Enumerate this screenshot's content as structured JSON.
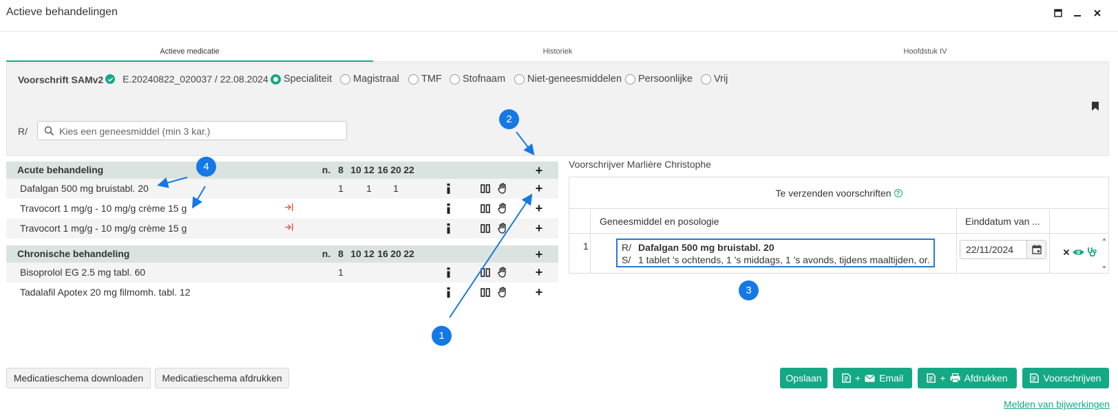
{
  "window": {
    "title": "Actieve behandelingen",
    "buttons": [
      "maximize-icon",
      "minimize-icon",
      "close-icon"
    ]
  },
  "tabs": [
    {
      "label": "Actieve medicatie",
      "active": true
    },
    {
      "label": "Historiek",
      "active": false
    },
    {
      "label": "Hoofdstuk IV",
      "active": false
    }
  ],
  "prescription": {
    "samv2_label": "Voorschrift SAMv2",
    "reference": "E.20240822_020037 / 22.08.2024",
    "types": [
      {
        "label": "Specialiteit",
        "selected": true
      },
      {
        "label": "Magistraal",
        "selected": false
      },
      {
        "label": "TMF",
        "selected": false
      },
      {
        "label": "Stofnaam",
        "selected": false
      },
      {
        "label": "Niet-geneesmiddelen",
        "selected": false
      },
      {
        "label": "Persoonlijke",
        "selected": false
      },
      {
        "label": "Vrij",
        "selected": false
      }
    ],
    "r_label": "R/",
    "search_placeholder": "Kies een geneesmiddel (min 3 kar.)"
  },
  "acute": {
    "title": "Acute behandeling",
    "columns": [
      "n.",
      "8",
      "10",
      "12",
      "16",
      "20",
      "22"
    ],
    "rows": [
      {
        "name": "Dafalgan 500 mg bruistabl. 20",
        "doses": {
          "8": "1",
          "12": "1",
          "20": "1"
        }
      },
      {
        "name": "Travocort 1 mg/g - 10 mg/g crème 15 g",
        "doses": {}
      },
      {
        "name": "Travocort 1 mg/g - 10 mg/g crème 15 g",
        "doses": {}
      }
    ]
  },
  "chronic": {
    "title": "Chronische behandeling",
    "columns": [
      "n.",
      "8",
      "10",
      "12",
      "16",
      "20",
      "22"
    ],
    "rows": [
      {
        "name": "Bisoprolol EG 2.5 mg tabl. 60",
        "doses": {
          "8": "1"
        }
      },
      {
        "name": "Tadalafil Apotex 20 mg filmomh. tabl. 12",
        "doses": {}
      }
    ]
  },
  "prescriber": "Voorschrijver Marlière Christophe",
  "to_send": {
    "title": "Te verzenden voorschriften",
    "col_medication": "Geneesmiddel en posologie",
    "col_enddate": "Einddatum van ...",
    "items": [
      {
        "num": "1",
        "r_prefix": "R/",
        "medication": "Dafalgan 500 mg bruistabl. 20",
        "s_prefix": "S/",
        "posology": "1 tablet 's ochtends, 1 's middags, 1 's avonds, tijdens maaltijden, or.",
        "end_date": "22/11/2024"
      }
    ]
  },
  "footer": {
    "download_schema": "Medicatieschema downloaden",
    "print_schema": "Medicatieschema afdrukken",
    "save": "Opslaan",
    "email": "Email",
    "print": "Afdrukken",
    "prescribe": "Voorschrijven",
    "plus_sign": "+",
    "report_link": "Melden van bijwerkingen"
  },
  "annotations": [
    "1",
    "2",
    "3",
    "4"
  ],
  "colors": {
    "accent": "#14a885",
    "annotation": "#1478e6",
    "transfer_arrow": "#e8584f"
  }
}
